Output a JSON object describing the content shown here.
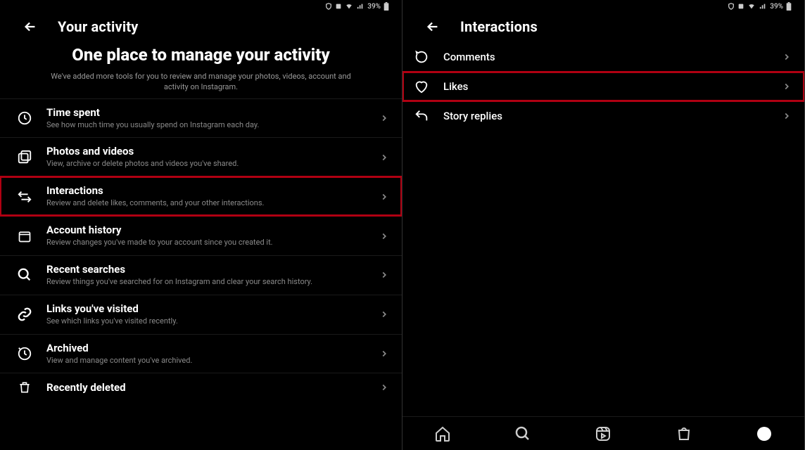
{
  "status": {
    "battery_pct": "39%"
  },
  "left": {
    "title": "Your activity",
    "hero_title": "One place to manage your activity",
    "hero_sub": "We've added more tools for you to review and manage your photos, videos, account and activity on Instagram.",
    "items": [
      {
        "title": "Time spent",
        "sub": "See how much time you usually spend on Instagram each day."
      },
      {
        "title": "Photos and videos",
        "sub": "View, archive or delete photos and videos you've shared."
      },
      {
        "title": "Interactions",
        "sub": "Review and delete likes, comments, and your other interactions."
      },
      {
        "title": "Account history",
        "sub": "Review changes you've made to your account since you created it."
      },
      {
        "title": "Recent searches",
        "sub": "Review things you've searched for on Instagram and clear your search history."
      },
      {
        "title": "Links you've visited",
        "sub": "See which links you've visited recently."
      },
      {
        "title": "Archived",
        "sub": "View and manage content you've archived."
      },
      {
        "title": "Recently deleted",
        "sub": ""
      }
    ]
  },
  "right": {
    "title": "Interactions",
    "items": [
      {
        "title": "Comments"
      },
      {
        "title": "Likes"
      },
      {
        "title": "Story replies"
      }
    ]
  }
}
